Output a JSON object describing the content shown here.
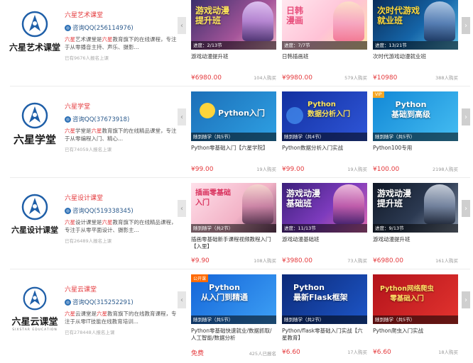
{
  "rows": [
    {
      "logo": {
        "text": "六星艺术课堂",
        "sub": ""
      },
      "name": "六星艺术课堂",
      "consult": "咨询QQ(256114976)",
      "desc_parts": [
        "六星",
        "艺术课堂是",
        "六星",
        "教育旗下的在线课程，专注于从零播音主持、声乐、摄影..."
      ],
      "enrolled": "已有9676人报名上课",
      "courses": [
        {
          "thumb_title": "游戏动漫\n提升班",
          "strip": "进度：2/13节",
          "title": "游戏动漫提升班",
          "price": "¥6980.00",
          "buyers": "104人购买"
        },
        {
          "thumb_title": "日韩\n漫画",
          "strip": "进度：7/7节",
          "title": "日韩插画班",
          "price": "¥9980.00",
          "buyers": "579人购买"
        },
        {
          "thumb_title": "次时代游戏\n就业班",
          "strip": "进度：13/21节",
          "title": "次时代游戏动漫就业班",
          "price": "¥10980",
          "buyers": "388人购买"
        }
      ]
    },
    {
      "logo": {
        "text": "六星学堂",
        "sub": ""
      },
      "name": "六星学堂",
      "consult": "咨询QQ(37673918)",
      "desc_parts": [
        "六星",
        "学堂是",
        "六星",
        "教育旗下的在线精品课堂，专注于从零编程入门、精心..."
      ],
      "enrolled": "已有74059人报名上课",
      "courses": [
        {
          "thumb_title": "Python入门",
          "strip": "随到随学（共5节）",
          "title": "Python零基础入门【六星学院】",
          "price": "¥99.00",
          "buyers": "19人购买"
        },
        {
          "thumb_title": "Python\n数据分析入门",
          "strip": "随到随学（共4节）",
          "title": "Python数据分析入门实战",
          "price": "¥99.00",
          "buyers": "19人购买"
        },
        {
          "thumb_title": "Python\n基础到高级",
          "strip": "随到随学（共5节）",
          "title": "Python100专用",
          "price": "¥100.00",
          "buyers": "2198人购买",
          "vip": "VIP"
        }
      ]
    },
    {
      "logo": {
        "text": "六星设计课堂",
        "sub": ""
      },
      "name": "六星设计课堂",
      "consult": "咨询QQ(519338345)",
      "desc_parts": [
        "六星",
        "设计课堂是",
        "六星",
        "教育旗下的在线精品课程，专注于从零平面设计、摄影主..."
      ],
      "enrolled": "已有26489人报名上课",
      "courses": [
        {
          "thumb_title": "插画零基础\n入门",
          "strip": "随到随学（共2节）",
          "title": "插画零基础新手课程视频教程入门【入里】",
          "price": "¥9.90",
          "buyers": "108人购买"
        },
        {
          "thumb_title": "游戏动漫\n基础班",
          "strip": "进度：11/13节",
          "title": "游戏动漫基础班",
          "price": "¥3980.00",
          "buyers": "73人购买"
        },
        {
          "thumb_title": "游戏动漫\n提升班",
          "strip": "进度：9/13节",
          "title": "游戏动漫提升班",
          "price": "¥6980.00",
          "buyers": "161人购买"
        }
      ]
    },
    {
      "logo": {
        "text": "六星云课堂",
        "sub": "SIXSTAR EDUCATION"
      },
      "name": "六星云课堂",
      "consult": "咨询QQ(315252291)",
      "desc_parts": [
        "六星",
        "云课堂是",
        "六星",
        "教育旗下的在线教育课程，专注于从零IT技能在线教育培训..."
      ],
      "enrolled": "已有278448人报名上课",
      "courses": [
        {
          "thumb_title": "Python\n从入门到精通",
          "strip": "随到随学（共5节）",
          "title": "Python零基础快速就业/数据抓取/人工智能/数据分析",
          "price": "免费",
          "buyers": "425人已报名",
          "vip": "公开课"
        },
        {
          "thumb_title": "Python\n最新Flask框架",
          "strip": "随到随学（共2节）",
          "title": "Python/flask零基础入门实战【六星教育】",
          "price": "¥6.60",
          "buyers": "17人购买"
        },
        {
          "thumb_title": "Python网络爬虫\n零基础入门",
          "strip": "随到随学（共5节）",
          "title": "Python爬虫入门实战",
          "price": "¥6.60",
          "buyers": "18人购买"
        }
      ]
    }
  ],
  "arrows": {
    "left": "‹",
    "right": "›"
  }
}
